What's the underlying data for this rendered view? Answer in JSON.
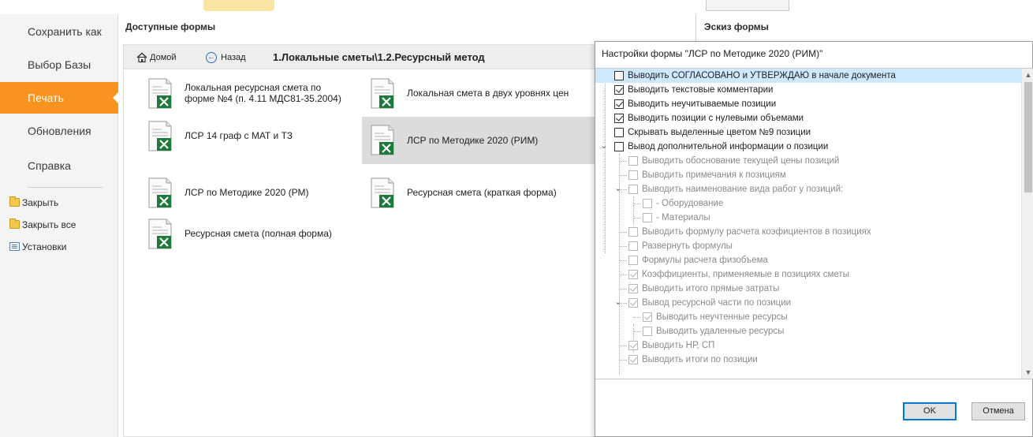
{
  "sidebar": {
    "items": [
      {
        "label": "Сохранить как",
        "active": false
      },
      {
        "label": "Выбор Базы",
        "active": false
      },
      {
        "label": "Печать",
        "active": true
      },
      {
        "label": "Обновления",
        "active": false
      },
      {
        "label": "Справка",
        "active": false
      }
    ],
    "commands": [
      {
        "label": "Закрыть",
        "icon": "folder-icon"
      },
      {
        "label": "Закрыть все",
        "icon": "folders-icon"
      },
      {
        "label": "Установки",
        "icon": "settings-icon"
      }
    ]
  },
  "forms_panel": {
    "title": "Доступные формы",
    "nav": {
      "home_label": "Домой",
      "back_label": "Назад",
      "path": "1.Локальные сметы\\1.2.Ресурсный метод"
    },
    "forms": [
      {
        "label": "Локальная ресурсная смета по форме №4 (п. 4.11 МДС81-35.2004)",
        "selected": false
      },
      {
        "label": "Локальная смета в двух уровнях цен",
        "selected": false
      },
      {
        "label": "ЛСР 14 граф с МАТ и ТЗ",
        "selected": false
      },
      {
        "label": "ЛСР по Методике 2020 (РИМ)",
        "selected": true
      },
      {
        "label": "ЛСР по Методике 2020 (РМ)",
        "selected": false
      },
      {
        "label": "Ресурсная смета (краткая форма)",
        "selected": false
      },
      {
        "label": "Ресурсная смета (полная форма)",
        "selected": false
      }
    ]
  },
  "sketch_panel": {
    "title": "Эскиз формы"
  },
  "dialog": {
    "title": "Настройки формы \"ЛСР по Методике 2020 (РИМ)\"",
    "options": [
      {
        "label": "Выводить СОГЛАСОВАНО и УТВЕРЖДАЮ в начале документа",
        "checked": false,
        "enabled": true,
        "level": 0,
        "expander": false,
        "selected": true
      },
      {
        "label": "Выводить текстовые комментарии",
        "checked": true,
        "enabled": true,
        "level": 0,
        "expander": false
      },
      {
        "label": "Выводить неучитываемые позиции",
        "checked": true,
        "enabled": true,
        "level": 0,
        "expander": false
      },
      {
        "label": "Выводить позиции с нулевыми объемами",
        "checked": true,
        "enabled": true,
        "level": 0,
        "expander": false
      },
      {
        "label": "Скрывать выделенные цветом №9 позиции",
        "checked": false,
        "enabled": true,
        "level": 0,
        "expander": false
      },
      {
        "label": "Вывод дополнительной информации о позиции",
        "checked": false,
        "enabled": true,
        "level": 0,
        "expander": true
      },
      {
        "label": "Выводить обоснование текущей цены позиций",
        "checked": false,
        "enabled": false,
        "level": 1,
        "expander": false
      },
      {
        "label": "Выводить примечания к позициям",
        "checked": false,
        "enabled": false,
        "level": 1,
        "expander": false
      },
      {
        "label": "Выводить наименование вида работ у позиций:",
        "checked": false,
        "enabled": false,
        "level": 1,
        "expander": true
      },
      {
        "label": "- Оборудование",
        "checked": false,
        "enabled": false,
        "level": 2,
        "expander": false
      },
      {
        "label": "- Материалы",
        "checked": false,
        "enabled": false,
        "level": 2,
        "expander": false
      },
      {
        "label": "Выводить формулу расчета коэфициентов в позициях",
        "checked": false,
        "enabled": false,
        "level": 1,
        "expander": false
      },
      {
        "label": "Развернуть формулы",
        "checked": false,
        "enabled": false,
        "level": 1,
        "expander": false
      },
      {
        "label": "Формулы расчета физобъема",
        "checked": false,
        "enabled": false,
        "level": 1,
        "expander": false
      },
      {
        "label": "Коэффициенты, применяемые в позициях сметы",
        "checked": true,
        "enabled": false,
        "level": 1,
        "expander": false
      },
      {
        "label": "Выводить итого прямые затраты",
        "checked": true,
        "enabled": false,
        "level": 1,
        "expander": false
      },
      {
        "label": "Вывод ресурсной части по позиции",
        "checked": true,
        "enabled": false,
        "level": 1,
        "expander": true
      },
      {
        "label": "Выводить неучтенные ресурсы",
        "checked": true,
        "enabled": false,
        "level": 2,
        "expander": false
      },
      {
        "label": "Выводить удаленные ресурсы",
        "checked": false,
        "enabled": false,
        "level": 2,
        "expander": false
      },
      {
        "label": "Выводить НР, СП",
        "checked": true,
        "enabled": false,
        "level": 1,
        "expander": false
      },
      {
        "label": "Выводить итоги по позиции",
        "checked": true,
        "enabled": false,
        "level": 1,
        "expander": false
      }
    ],
    "ok_label": "OK",
    "cancel_label": "Отмена"
  }
}
